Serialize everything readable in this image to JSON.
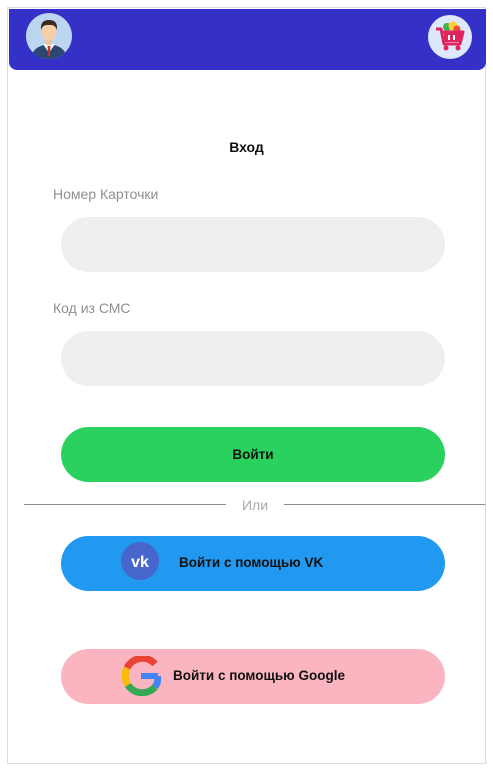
{
  "header": {
    "avatar_icon": "user-avatar-icon",
    "cart_icon": "shopping-cart-icon",
    "bar_color": "#3430c8"
  },
  "form": {
    "title": "Вход",
    "card_label": "Номер Карточки",
    "card_value": "",
    "sms_label": "Код из СМС",
    "sms_value": "",
    "login_button": "Войти"
  },
  "divider": {
    "text": "Или"
  },
  "social": {
    "vk_label": "Войти с помощью VK",
    "vk_icon": "vk-logo-icon",
    "vk_color": "#2199f0",
    "google_label": "Войти с помощью Google",
    "google_icon": "google-logo-icon",
    "google_color": "#fbb5c0"
  },
  "colors": {
    "login_button": "#2bd15f",
    "input_bg": "#efeff1"
  }
}
